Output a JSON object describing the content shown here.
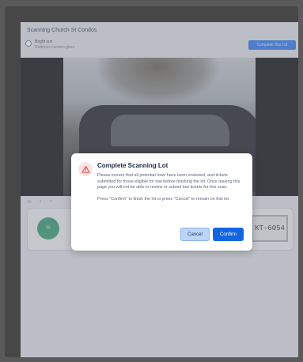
{
  "header": {
    "title": "Scanning Church St Condos",
    "bright_label": "Bright sun",
    "bright_sub": "Reduces camera glare",
    "complete_button": "Complete this Lot"
  },
  "filters": [
    "All",
    "T",
    "T"
  ],
  "card": {
    "avatar_text": "St",
    "plate_text": "KT-6054"
  },
  "modal": {
    "title": "Complete Scanning Lot",
    "body1": "Please ensure that all potential tows have been reviewed, and tickets submitted for those eligible for tow before finishing the lot. Once leaving this page you will not be able to review or submit tow tickets for this scan.",
    "body2": "Press \"Confirm\" to finish the lot or press \"Cancel\" to remain on this lot.",
    "cancel": "Cancel",
    "confirm": "Confirm"
  },
  "colors": {
    "accent": "#1466e0",
    "warning": "#e23b3b"
  }
}
